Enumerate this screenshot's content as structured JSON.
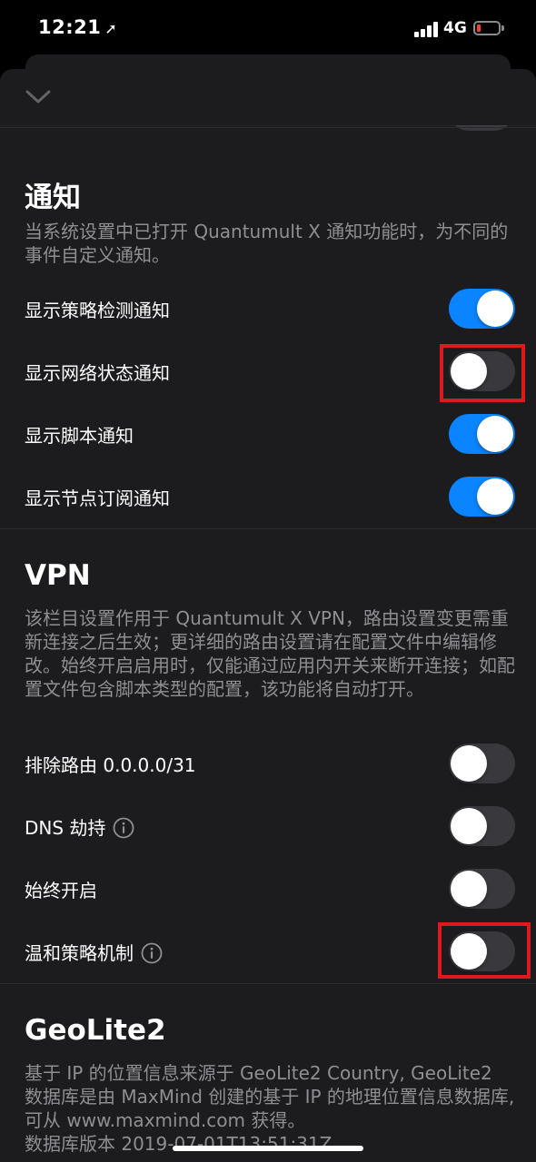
{
  "status_bar": {
    "time": "12:21",
    "location_glyph": "➚",
    "network": "4G",
    "battery_color": "#ff3b30"
  },
  "header": {
    "collapse_icon": "chevron-down-icon"
  },
  "sections": {
    "notifications": {
      "title": "通知",
      "description": "当系统设置中已打开 Quantumult X 通知功能时，为不同的事件自定义通知。",
      "rows": [
        {
          "label": "显示策略检测通知",
          "on": true
        },
        {
          "label": "显示网络状态通知",
          "on": false
        },
        {
          "label": "显示脚本通知",
          "on": true
        },
        {
          "label": "显示节点订阅通知",
          "on": true
        }
      ]
    },
    "vpn": {
      "title": "VPN",
      "description": "该栏目设置作用于 Quantumult X VPN，路由设置变更需重新连接之后生效；更详细的路由设置请在配置文件中编辑修改。始终开启启用时，仅能通过应用内开关来断开连接；如配置文件包含脚本类型的配置，该功能将自动打开。",
      "rows": [
        {
          "label": "排除路由 0.0.0.0/31",
          "on": false,
          "info": false
        },
        {
          "label": "DNS 劫持",
          "on": false,
          "info": true
        },
        {
          "label": "始终开启",
          "on": false,
          "info": false
        },
        {
          "label": "温和策略机制",
          "on": false,
          "info": true
        }
      ]
    },
    "geolite": {
      "title": "GeoLite2",
      "description": "基于 IP 的位置信息来源于 GeoLite2 Country, GeoLite2 数据库是由 MaxMind 创建的基于 IP 的地理位置信息数据库, 可从 www.maxmind.com 获得。",
      "version": "数据库版本 2019-07-01T13:51:31Z"
    }
  },
  "colors": {
    "toggle_on": "#0a84ff",
    "toggle_off": "#39393d",
    "highlight": "#e0191e",
    "sheet_bg": "#1c1c1e",
    "secondary_text": "#8e8e93"
  }
}
